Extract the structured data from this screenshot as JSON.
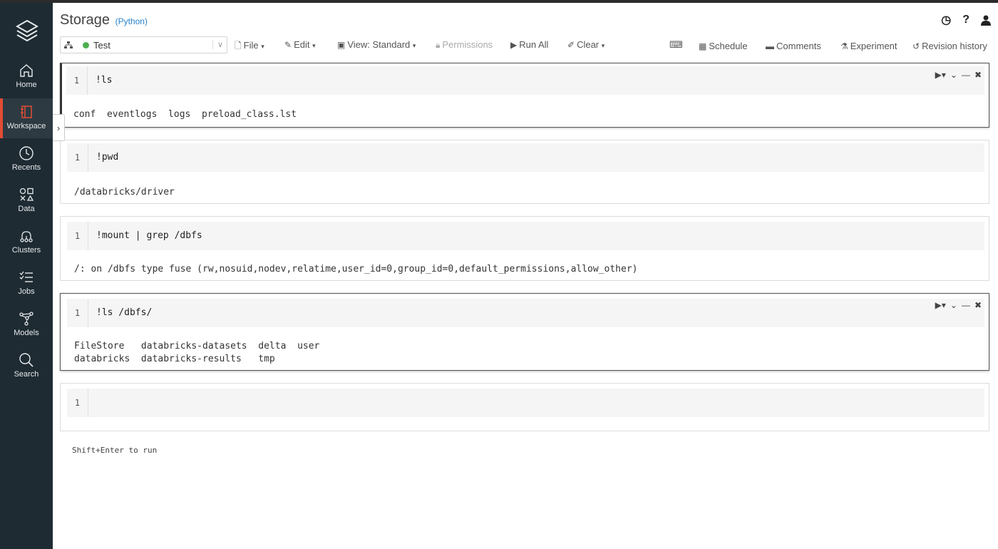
{
  "sidebar": {
    "items": [
      {
        "label": "Home",
        "icon": "home-icon"
      },
      {
        "label": "Workspace",
        "icon": "workspace-icon"
      },
      {
        "label": "Recents",
        "icon": "clock-icon"
      },
      {
        "label": "Data",
        "icon": "data-icon"
      },
      {
        "label": "Clusters",
        "icon": "clusters-icon"
      },
      {
        "label": "Jobs",
        "icon": "jobs-icon"
      },
      {
        "label": "Models",
        "icon": "models-icon"
      },
      {
        "label": "Search",
        "icon": "search-icon"
      }
    ]
  },
  "header": {
    "title": "Storage",
    "language": "(Python)"
  },
  "toolbar": {
    "cluster_name": "Test",
    "file": "File",
    "edit": "Edit",
    "view": "View: Standard",
    "permissions": "Permissions",
    "run_all": "Run All",
    "clear": "Clear",
    "schedule": "Schedule",
    "comments": "Comments",
    "experiment": "Experiment",
    "revision_history": "Revision history"
  },
  "cells": [
    {
      "line": "1",
      "code": "!ls",
      "output": "conf  eventlogs  logs  preload_class.lst"
    },
    {
      "line": "1",
      "code": "!pwd",
      "output": "/databricks/driver"
    },
    {
      "line": "1",
      "code": "!mount | grep /dbfs",
      "output": "/: on /dbfs type fuse (rw,nosuid,nodev,relatime,user_id=0,group_id=0,default_permissions,allow_other)"
    },
    {
      "line": "1",
      "code": "!ls /dbfs/",
      "output": "FileStore   databricks-datasets  delta  user\ndatabricks  databricks-results   tmp"
    },
    {
      "line": "1",
      "code": "",
      "output": ""
    }
  ],
  "hint": "Shift+Enter to run",
  "colors": {
    "sidebar_bg": "#1e2b33",
    "active_accent": "#e14c34",
    "cluster_running": "#4caf50",
    "link": "#2a82c9"
  }
}
